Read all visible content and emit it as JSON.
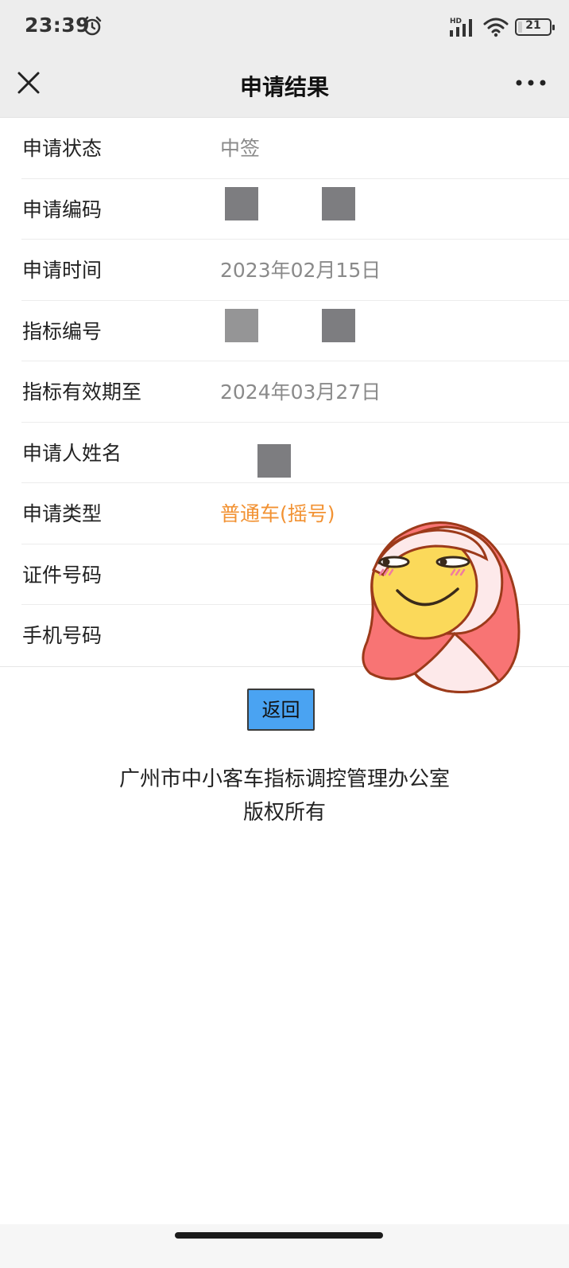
{
  "status_bar": {
    "time": "23:39",
    "network_label": "HD",
    "battery_level": 21,
    "battery_text": "21"
  },
  "navbar": {
    "title": "申请结果",
    "close_icon": "close-icon",
    "more_icon": "more-icon"
  },
  "rows": [
    {
      "label": "申请状态",
      "value": "中签"
    },
    {
      "label": "申请编码",
      "value": ""
    },
    {
      "label": "申请时间",
      "value": "2023年02月15日"
    },
    {
      "label": "指标编号",
      "value": ""
    },
    {
      "label": "指标有效期至",
      "value": "2024年03月27日"
    },
    {
      "label": "申请人姓名",
      "value": ""
    },
    {
      "label": "申请类型",
      "value": "普通车(摇号)"
    },
    {
      "label": "证件号码",
      "value": ""
    },
    {
      "label": "手机号码",
      "value": ""
    }
  ],
  "back_button": {
    "label": "返回"
  },
  "footer": {
    "line1": "广州市中小客车指标调控管理办公室",
    "line2": "版权所有"
  },
  "colors": {
    "bar_background": "#ededed",
    "value_gray": "#8a8a8a",
    "type_orange": "#f29233",
    "button_blue": "#4aa3f2"
  }
}
